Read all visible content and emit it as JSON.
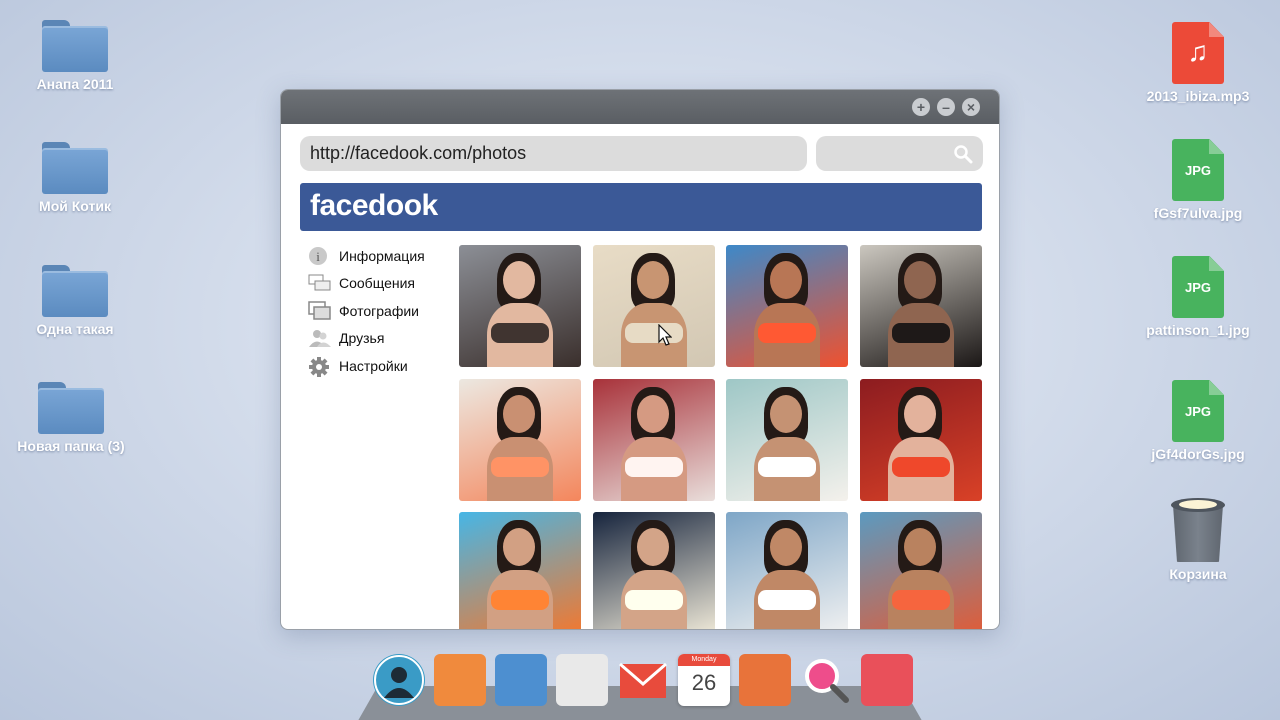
{
  "desktop": {
    "left_icons": [
      {
        "label": "Анапа 2011",
        "type": "folder"
      },
      {
        "label": "Мой Котик",
        "type": "folder"
      },
      {
        "label": "Одна такая",
        "type": "folder"
      },
      {
        "label": "Новая папка (3)",
        "type": "folder"
      }
    ],
    "right_icons": [
      {
        "label": "2013_ibiza.mp3",
        "type": "mp3",
        "glyph": "♫"
      },
      {
        "label": "fGsf7ulva.jpg",
        "type": "jpg",
        "glyph": "JPG"
      },
      {
        "label": "pattinson_1.jpg",
        "type": "jpg",
        "glyph": "JPG"
      },
      {
        "label": "jGf4dorGs.jpg",
        "type": "jpg",
        "glyph": "JPG"
      },
      {
        "label": "Корзина",
        "type": "trash"
      }
    ]
  },
  "browser": {
    "controls": {
      "add": "+",
      "minimize": "–",
      "close": "×"
    },
    "url": "http://facedook.com/photos",
    "search_placeholder": "",
    "brand": "facedook",
    "menu": [
      {
        "label": "Информация",
        "icon": "info-icon"
      },
      {
        "label": "Сообщения",
        "icon": "messages-icon"
      },
      {
        "label": "Фотографии",
        "icon": "photos-icon"
      },
      {
        "label": "Друзья",
        "icon": "friends-icon"
      },
      {
        "label": "Настройки",
        "icon": "settings-icon"
      }
    ],
    "photos": [
      {
        "bg": "#8c8f96",
        "accent": "#3a2f2c",
        "skin": "#e2b8a0"
      },
      {
        "bg": "#e8dcc6",
        "accent": "#d2c7b3",
        "skin": "#c89572"
      },
      {
        "bg": "#3d89c9",
        "accent": "#f0512e",
        "skin": "#b87655"
      },
      {
        "bg": "#cbc7bf",
        "accent": "#1b1716",
        "skin": "#8f6550"
      },
      {
        "bg": "#ece8e1",
        "accent": "#f4865c",
        "skin": "#c99072"
      },
      {
        "bg": "#a8323a",
        "accent": "#e9dedb",
        "skin": "#d59a82"
      },
      {
        "bg": "#9ec7c6",
        "accent": "#f4f1ec",
        "skin": "#c59273"
      },
      {
        "bg": "#8c1c20",
        "accent": "#d94127",
        "skin": "#e3b29c"
      },
      {
        "bg": "#46b6e6",
        "accent": "#f2782f",
        "skin": "#d2a083"
      },
      {
        "bg": "#16243d",
        "accent": "#efe9d8",
        "skin": "#d3a488"
      },
      {
        "bg": "#7ea6c7",
        "accent": "#f1f1f1",
        "skin": "#c08866"
      },
      {
        "bg": "#5b9ac0",
        "accent": "#e05c38",
        "skin": "#b9825f"
      }
    ]
  },
  "dock": [
    {
      "name": "contacts-icon",
      "color": "#3a9bc6"
    },
    {
      "name": "camera-icon",
      "color": "#f08a3d"
    },
    {
      "name": "photos-app-icon",
      "color": "#4d8fd0"
    },
    {
      "name": "maps-icon",
      "color": "#e9e9e9"
    },
    {
      "name": "mail-icon",
      "color": "#e84b3c"
    },
    {
      "name": "calendar-icon",
      "color": "#ffffff",
      "header": "Monday",
      "day": "26"
    },
    {
      "name": "screenshot-icon",
      "color": "#e8733a"
    },
    {
      "name": "search-app-icon",
      "color": "#ee4d8b"
    },
    {
      "name": "notes-icon",
      "color": "#e9505a"
    }
  ]
}
